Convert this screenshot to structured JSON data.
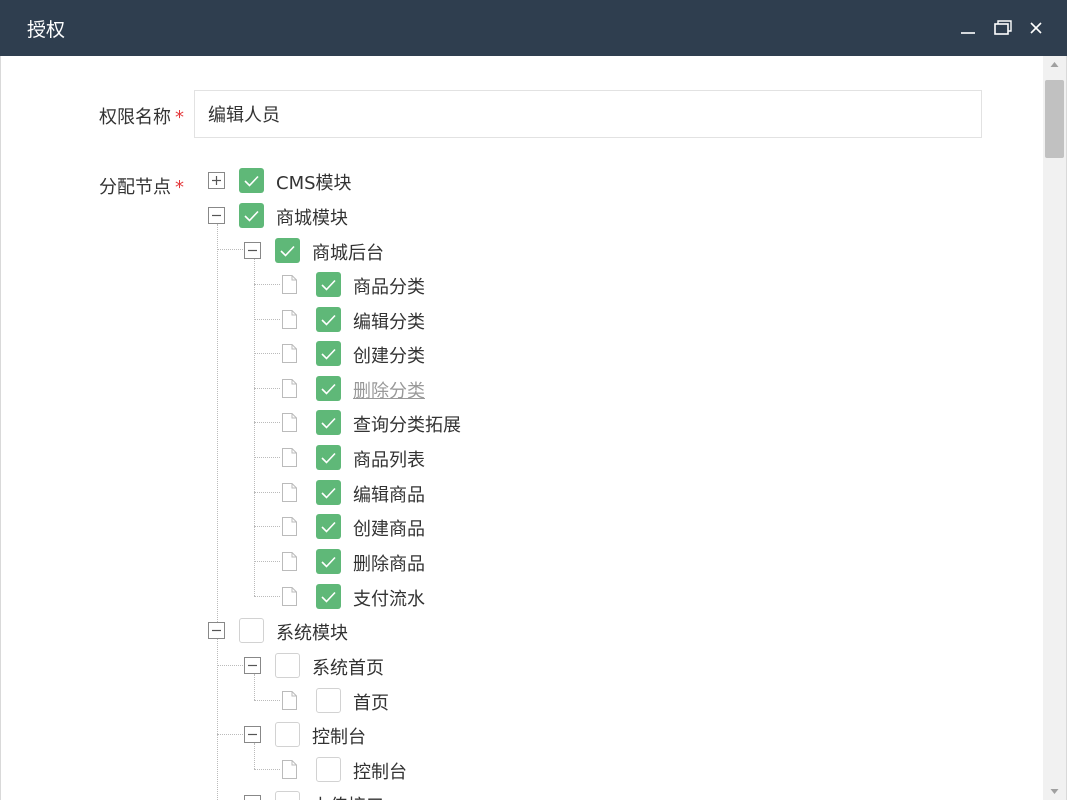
{
  "window": {
    "title": "授权"
  },
  "form": {
    "name_label": "权限名称",
    "name_required": "*",
    "name_value": "编辑人员",
    "nodes_label": "分配节点",
    "nodes_required": "*"
  },
  "tree": {
    "cms": {
      "label": "CMS模块",
      "checked": true,
      "expanded": false
    },
    "shop": {
      "label": "商城模块",
      "checked": true,
      "expanded": true
    },
    "shop_admin": {
      "label": "商城后台",
      "checked": true,
      "expanded": true
    },
    "shop_admin_items": [
      {
        "label": "商品分类",
        "checked": true
      },
      {
        "label": "编辑分类",
        "checked": true
      },
      {
        "label": "创建分类",
        "checked": true
      },
      {
        "label": "删除分类",
        "checked": true,
        "disabled": true
      },
      {
        "label": "查询分类拓展",
        "checked": true
      },
      {
        "label": "商品列表",
        "checked": true
      },
      {
        "label": "编辑商品",
        "checked": true
      },
      {
        "label": "创建商品",
        "checked": true
      },
      {
        "label": "删除商品",
        "checked": true
      },
      {
        "label": "支付流水",
        "checked": true
      }
    ],
    "system": {
      "label": "系统模块",
      "checked": false,
      "expanded": true
    },
    "system_home": {
      "label": "系统首页",
      "checked": false,
      "expanded": true
    },
    "system_home_items": [
      {
        "label": "首页",
        "checked": false
      }
    ],
    "console": {
      "label": "控制台",
      "checked": false,
      "expanded": true
    },
    "console_items": [
      {
        "label": "控制台",
        "checked": false
      }
    ],
    "upload": {
      "label": "上传接口",
      "checked": false,
      "expanded": true
    }
  },
  "colors": {
    "titlebar": "#2f3e4f",
    "check_on": "#5fb878",
    "required": "#e4393c"
  }
}
